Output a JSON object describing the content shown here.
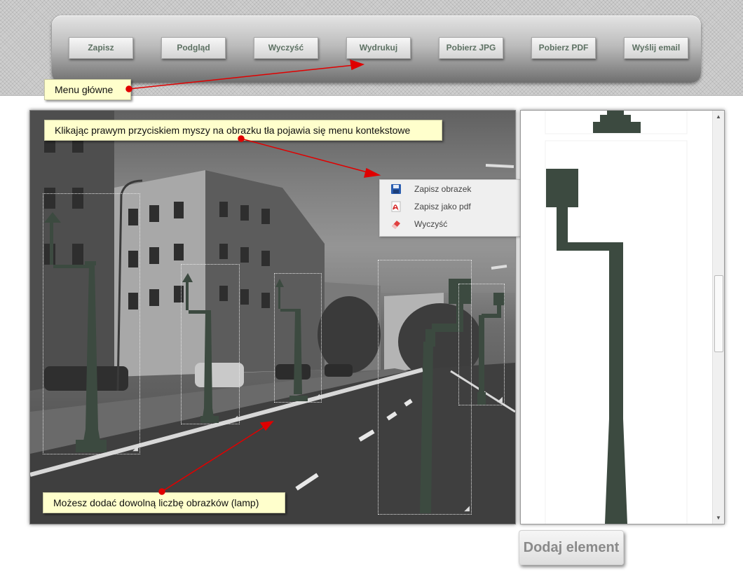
{
  "menu": {
    "buttons": [
      "Zapisz",
      "Podgląd",
      "Wyczyść",
      "Wydrukuj",
      "Pobierz JPG",
      "Pobierz PDF",
      "Wyślij email"
    ]
  },
  "callouts": {
    "menu_label": "Menu główne",
    "context_hint": "Klikając prawym przyciskiem myszy na obrazku tła pojawia się menu kontekstowe",
    "lamps_hint": "Możesz dodać dowolną liczbę obrazków (lamp)"
  },
  "context_menu": {
    "items": [
      {
        "label": "Zapisz obrazek",
        "icon": "floppy-disk-icon"
      },
      {
        "label": "Zapisz jako pdf",
        "icon": "pdf-icon"
      },
      {
        "label": "Wyczyść",
        "icon": "eraser-icon"
      }
    ]
  },
  "sidebar": {
    "add_button": "Dodaj element"
  },
  "colors": {
    "lamp": "#3c4a40",
    "button_text": "#5d7163",
    "callout_bg": "#ffffcc",
    "arrow": "#e00000"
  }
}
